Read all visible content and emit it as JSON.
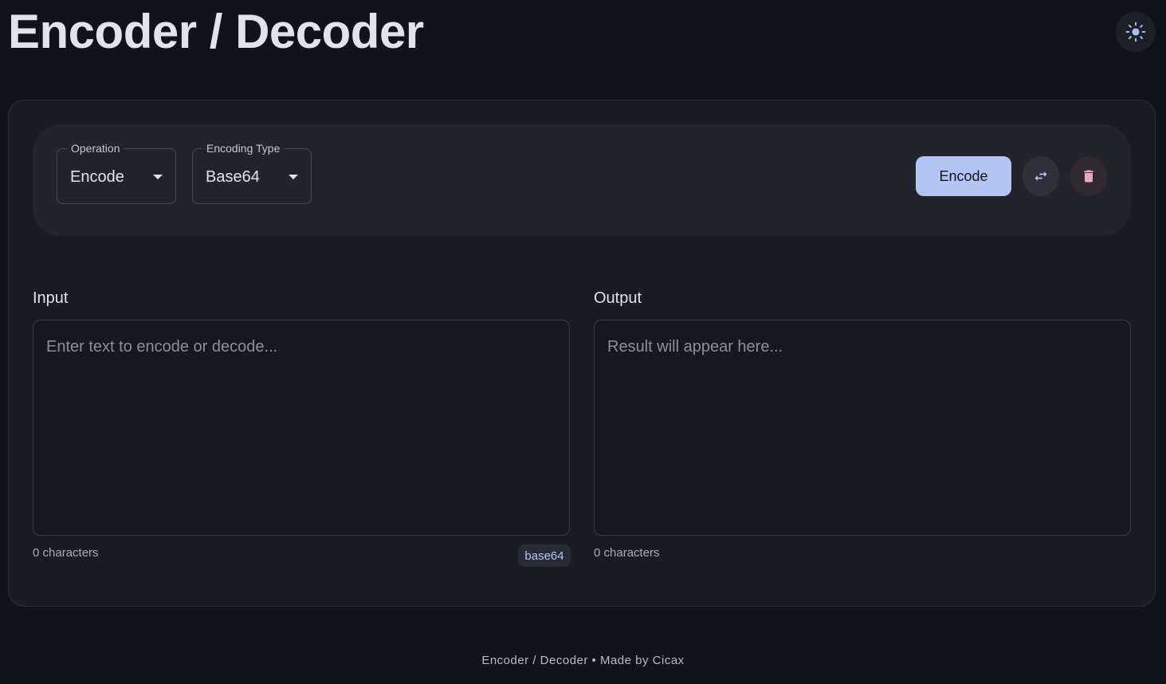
{
  "header": {
    "title": "Encoder / Decoder",
    "theme_toggle_icon": "sun-icon"
  },
  "toolbar": {
    "operation": {
      "label": "Operation",
      "value": "Encode"
    },
    "encoding_type": {
      "label": "Encoding Type",
      "value": "Base64"
    },
    "action_button_label": "Encode",
    "swap_icon": "swap-arrows-icon",
    "clear_icon": "trash-icon"
  },
  "input": {
    "label": "Input",
    "placeholder": "Enter text to encode or decode...",
    "value": "",
    "char_count": "0 characters",
    "badge": "base64"
  },
  "output": {
    "label": "Output",
    "placeholder": "Result will appear here...",
    "value": "",
    "char_count": "0 characters"
  },
  "footer": {
    "text": "Encoder / Decoder • Made by Cicax"
  },
  "colors": {
    "background": "#111318",
    "card": "#191c22",
    "toolbar": "#21242b",
    "accent": "#b4c5f5",
    "danger_icon": "#e8a8bf"
  }
}
